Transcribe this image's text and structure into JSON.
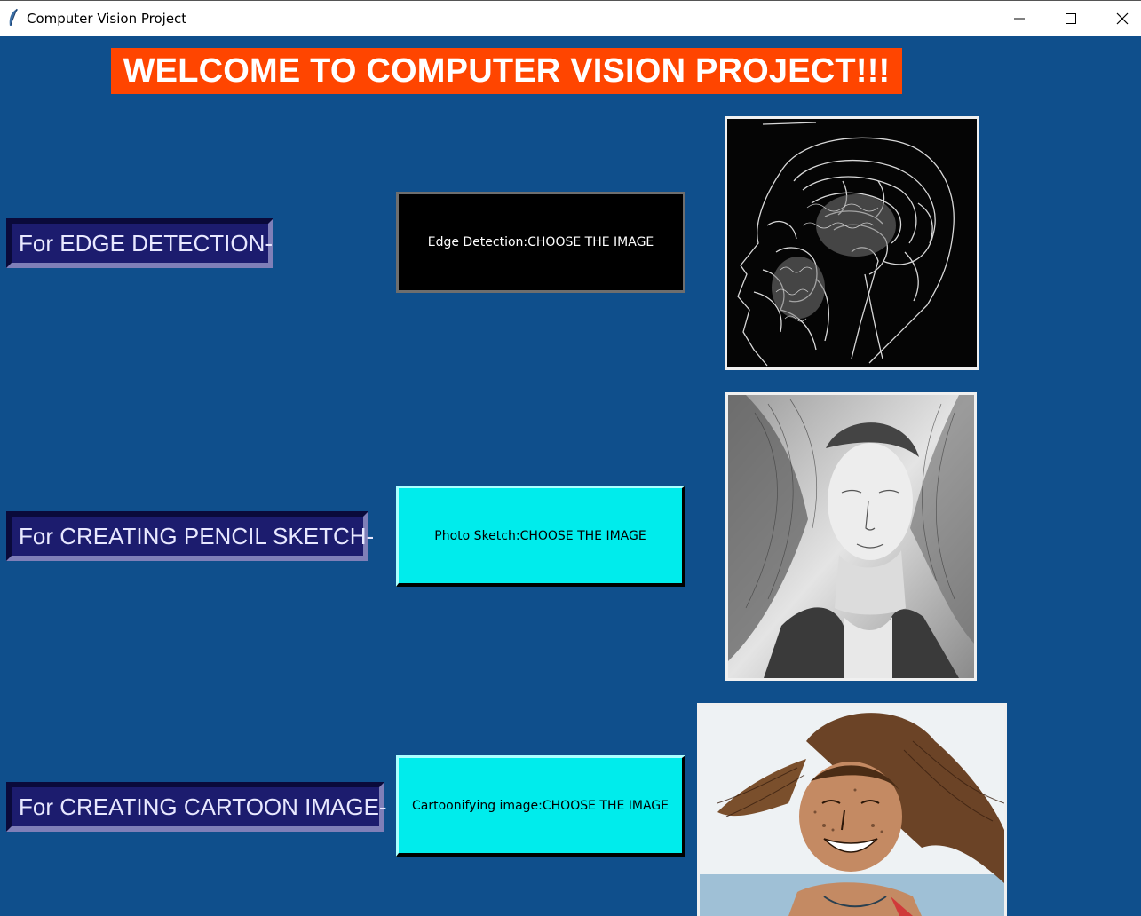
{
  "window": {
    "title": "Computer Vision Project",
    "controls": [
      "minimize-icon",
      "maximize-icon",
      "close-icon"
    ]
  },
  "header": {
    "welcome_text": "WELCOME TO COMPUTER VISION PROJECT!!!",
    "background": "#ff4500"
  },
  "sections": [
    {
      "label": "For EDGE DETECTION-",
      "button_label": "Edge Detection:CHOOSE THE IMAGE",
      "button_color": "#000000",
      "preview": "edge-detected-head-mri"
    },
    {
      "label": "For CREATING PENCIL SKETCH-",
      "button_label": "Photo Sketch:CHOOSE THE IMAGE",
      "button_color": "#00ecec",
      "preview": "pencil-sketch-portrait"
    },
    {
      "label": "For CREATING CARTOON IMAGE-",
      "button_label": "Cartoonifying image:CHOOSE THE IMAGE",
      "button_color": "#00ecec",
      "preview": "cartoonified-girl-photo"
    }
  ],
  "colors": {
    "background": "#0f4f8c",
    "label_bg": "#1c1c6e",
    "label_text": "#e8e8ff"
  }
}
